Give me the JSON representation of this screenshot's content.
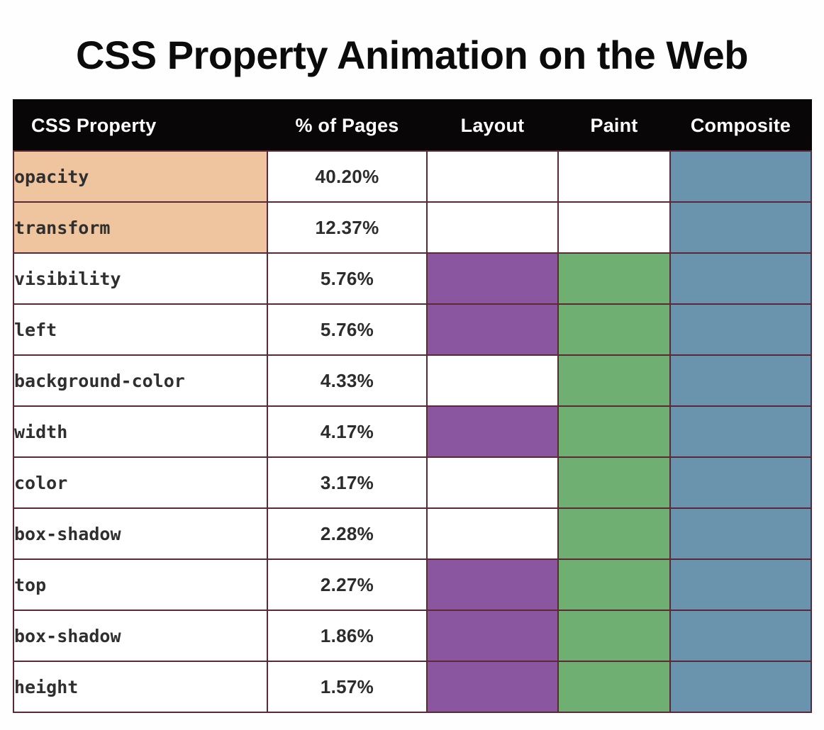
{
  "title": "CSS Property Animation on the Web",
  "colors": {
    "header_bg": "#090607",
    "header_text": "#ffffff",
    "border": "#5a2836",
    "highlight_property": "#efc59f",
    "layout": "#8a56a0",
    "paint": "#6fb072",
    "composite": "#6a93ae",
    "cell_bg": "#ffffff",
    "page_bg": "#fefefe",
    "title_text": "#0b0b0b"
  },
  "chart_data": {
    "type": "table",
    "title": "CSS Property Animation on the Web",
    "xlabel": "",
    "ylabel": "",
    "grid": true,
    "legend_position": "none",
    "columns": [
      "CSS Property",
      "% of Pages",
      "Layout",
      "Paint",
      "Composite"
    ],
    "categories": [
      "opacity",
      "transform",
      "visibility",
      "left",
      "background-color",
      "width",
      "color",
      "box-shadow",
      "top",
      "box-shadow",
      "height"
    ],
    "values": [
      40.2,
      12.37,
      5.76,
      5.76,
      4.33,
      4.17,
      3.17,
      2.28,
      2.27,
      1.86,
      1.57
    ],
    "series": [
      {
        "name": "% of Pages",
        "values": [
          40.2,
          12.37,
          5.76,
          5.76,
          4.33,
          4.17,
          3.17,
          2.28,
          2.27,
          1.86,
          1.57
        ]
      },
      {
        "name": "Layout",
        "values": [
          0,
          0,
          1,
          1,
          0,
          1,
          0,
          0,
          1,
          1,
          1
        ]
      },
      {
        "name": "Paint",
        "values": [
          0,
          0,
          1,
          1,
          1,
          1,
          1,
          1,
          1,
          1,
          1
        ]
      },
      {
        "name": "Composite",
        "values": [
          1,
          1,
          1,
          1,
          1,
          1,
          1,
          1,
          1,
          1,
          1
        ]
      }
    ],
    "rows": [
      {
        "property": "opacity",
        "percent": "40.20%",
        "layout": false,
        "paint": false,
        "composite": true,
        "highlight": true
      },
      {
        "property": "transform",
        "percent": "12.37%",
        "layout": false,
        "paint": false,
        "composite": true,
        "highlight": true
      },
      {
        "property": "visibility",
        "percent": "5.76%",
        "layout": true,
        "paint": true,
        "composite": true,
        "highlight": false
      },
      {
        "property": "left",
        "percent": "5.76%",
        "layout": true,
        "paint": true,
        "composite": true,
        "highlight": false
      },
      {
        "property": "background-color",
        "percent": "4.33%",
        "layout": false,
        "paint": true,
        "composite": true,
        "highlight": false
      },
      {
        "property": "width",
        "percent": "4.17%",
        "layout": true,
        "paint": true,
        "composite": true,
        "highlight": false
      },
      {
        "property": "color",
        "percent": "3.17%",
        "layout": false,
        "paint": true,
        "composite": true,
        "highlight": false
      },
      {
        "property": "box-shadow",
        "percent": "2.28%",
        "layout": false,
        "paint": true,
        "composite": true,
        "highlight": false
      },
      {
        "property": "top",
        "percent": "2.27%",
        "layout": true,
        "paint": true,
        "composite": true,
        "highlight": false
      },
      {
        "property": "box-shadow",
        "percent": "1.86%",
        "layout": true,
        "paint": true,
        "composite": true,
        "highlight": false
      },
      {
        "property": "height",
        "percent": "1.57%",
        "layout": true,
        "paint": true,
        "composite": true,
        "highlight": false
      }
    ]
  }
}
